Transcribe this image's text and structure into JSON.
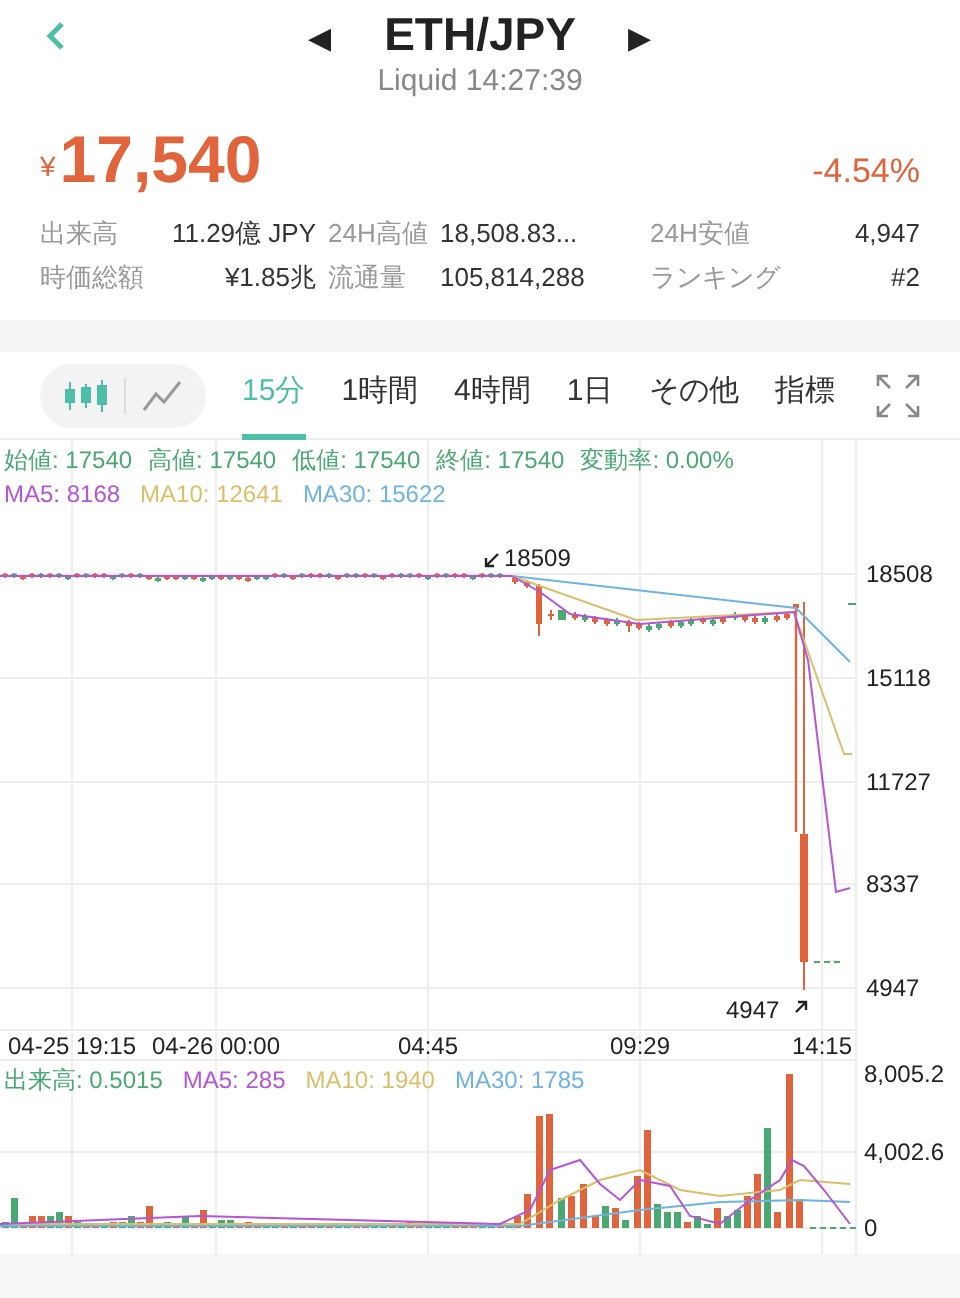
{
  "header": {
    "title": "ETH/JPY",
    "subtitle": "Liquid 14:27:39",
    "prev": "◀",
    "next": "▶"
  },
  "price": {
    "currency": "¥",
    "value": "17,540",
    "change": "-4.54%"
  },
  "stats": [
    {
      "label": "出来高",
      "value": "11.29億 JPY"
    },
    {
      "label": "24H高値",
      "value": "18,508.83..."
    },
    {
      "label": "24H安値",
      "value": "4,947"
    },
    {
      "label": "時価総額",
      "value": "¥1.85兆"
    },
    {
      "label": "流通量",
      "value": "105,814,288"
    },
    {
      "label": "ランキング",
      "value": "#2"
    }
  ],
  "chart_types": [
    {
      "kind": "candle",
      "selected": true
    },
    {
      "kind": "line",
      "selected": false
    }
  ],
  "tabs": [
    {
      "label": "15分",
      "selected": true
    },
    {
      "label": "1時間",
      "selected": false
    },
    {
      "label": "4時間",
      "selected": false
    },
    {
      "label": "1日",
      "selected": false
    },
    {
      "label": "その他",
      "selected": false
    },
    {
      "label": "指標",
      "selected": false
    }
  ],
  "ohlc": [
    "始値: 17540",
    "高値: 17540",
    "低値: 17540",
    "終値: 17540",
    "変動率: 0.00%"
  ],
  "price_ma": [
    {
      "text": "MA5: 8168",
      "color": "#b455d6"
    },
    {
      "text": "MA10: 12641",
      "color": "#d9bf6a"
    },
    {
      "text": "MA30: 15622",
      "color": "#6fb3e0"
    }
  ],
  "price_axis": [
    "18508",
    "15118",
    "11727",
    "8337",
    "4947"
  ],
  "max_label": "18509",
  "min_label": "4947",
  "time_axis": [
    "04-25 19:15",
    "04-26 00:00",
    "04:45",
    "09:29",
    "14:15"
  ],
  "volume_legend": [
    {
      "text": "出来高: 0.5015",
      "color": "#4aa872"
    },
    {
      "text": "MA5: 285",
      "color": "#b455d6"
    },
    {
      "text": "MA10: 1940",
      "color": "#d9bf6a"
    },
    {
      "text": "MA30: 1785",
      "color": "#6fb3e0"
    }
  ],
  "volume_axis": [
    "8,005.2",
    "4,002.6",
    "0"
  ]
}
